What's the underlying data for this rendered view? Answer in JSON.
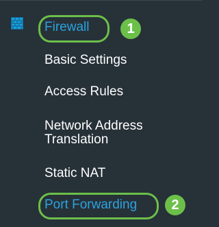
{
  "colors": {
    "background": "#273138",
    "text": "#ffffff",
    "active_text": "#2aa3e0",
    "highlight": "#6cc04a",
    "icon_fill": "#1a9fdc"
  },
  "menu": {
    "section": {
      "label": "Firewall",
      "icon": "firewall-brick-icon",
      "step_badge": "1"
    },
    "items": [
      {
        "label": "Basic Settings"
      },
      {
        "label": "Access Rules"
      },
      {
        "label": "Network Address Translation"
      },
      {
        "label": "Static NAT"
      },
      {
        "label": "Port Forwarding",
        "step_badge": "2"
      }
    ]
  }
}
